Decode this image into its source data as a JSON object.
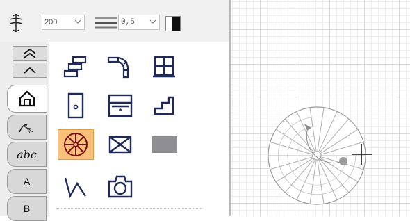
{
  "toolbar": {
    "height_value": "200",
    "line_width_value": "0,5",
    "stroke_color": "#111111"
  },
  "tabs": [
    {
      "icon": "double-chevron-up-icon"
    },
    {
      "icon": "chevron-up-icon"
    },
    {
      "icon": "house-icon",
      "active": true
    },
    {
      "icon": "landscape-icon"
    },
    {
      "label": "abc"
    },
    {
      "label": "A"
    },
    {
      "label": "B"
    }
  ],
  "tools": [
    {
      "icon": "wall-icon"
    },
    {
      "icon": "curved-wall-icon"
    },
    {
      "icon": "window-icon"
    },
    {
      "icon": "door-icon"
    },
    {
      "icon": "cabinet-icon"
    },
    {
      "icon": "stairs-icon"
    },
    {
      "icon": "spiral-staircase-icon",
      "selected": true
    },
    {
      "icon": "box-cross-icon"
    },
    {
      "icon": "gray-rectangle-icon"
    },
    {
      "icon": "polyline-icon"
    },
    {
      "icon": "camera-icon"
    }
  ],
  "colors": {
    "selection": "#f9c07a",
    "icon_stroke": "#1f2a5a"
  }
}
